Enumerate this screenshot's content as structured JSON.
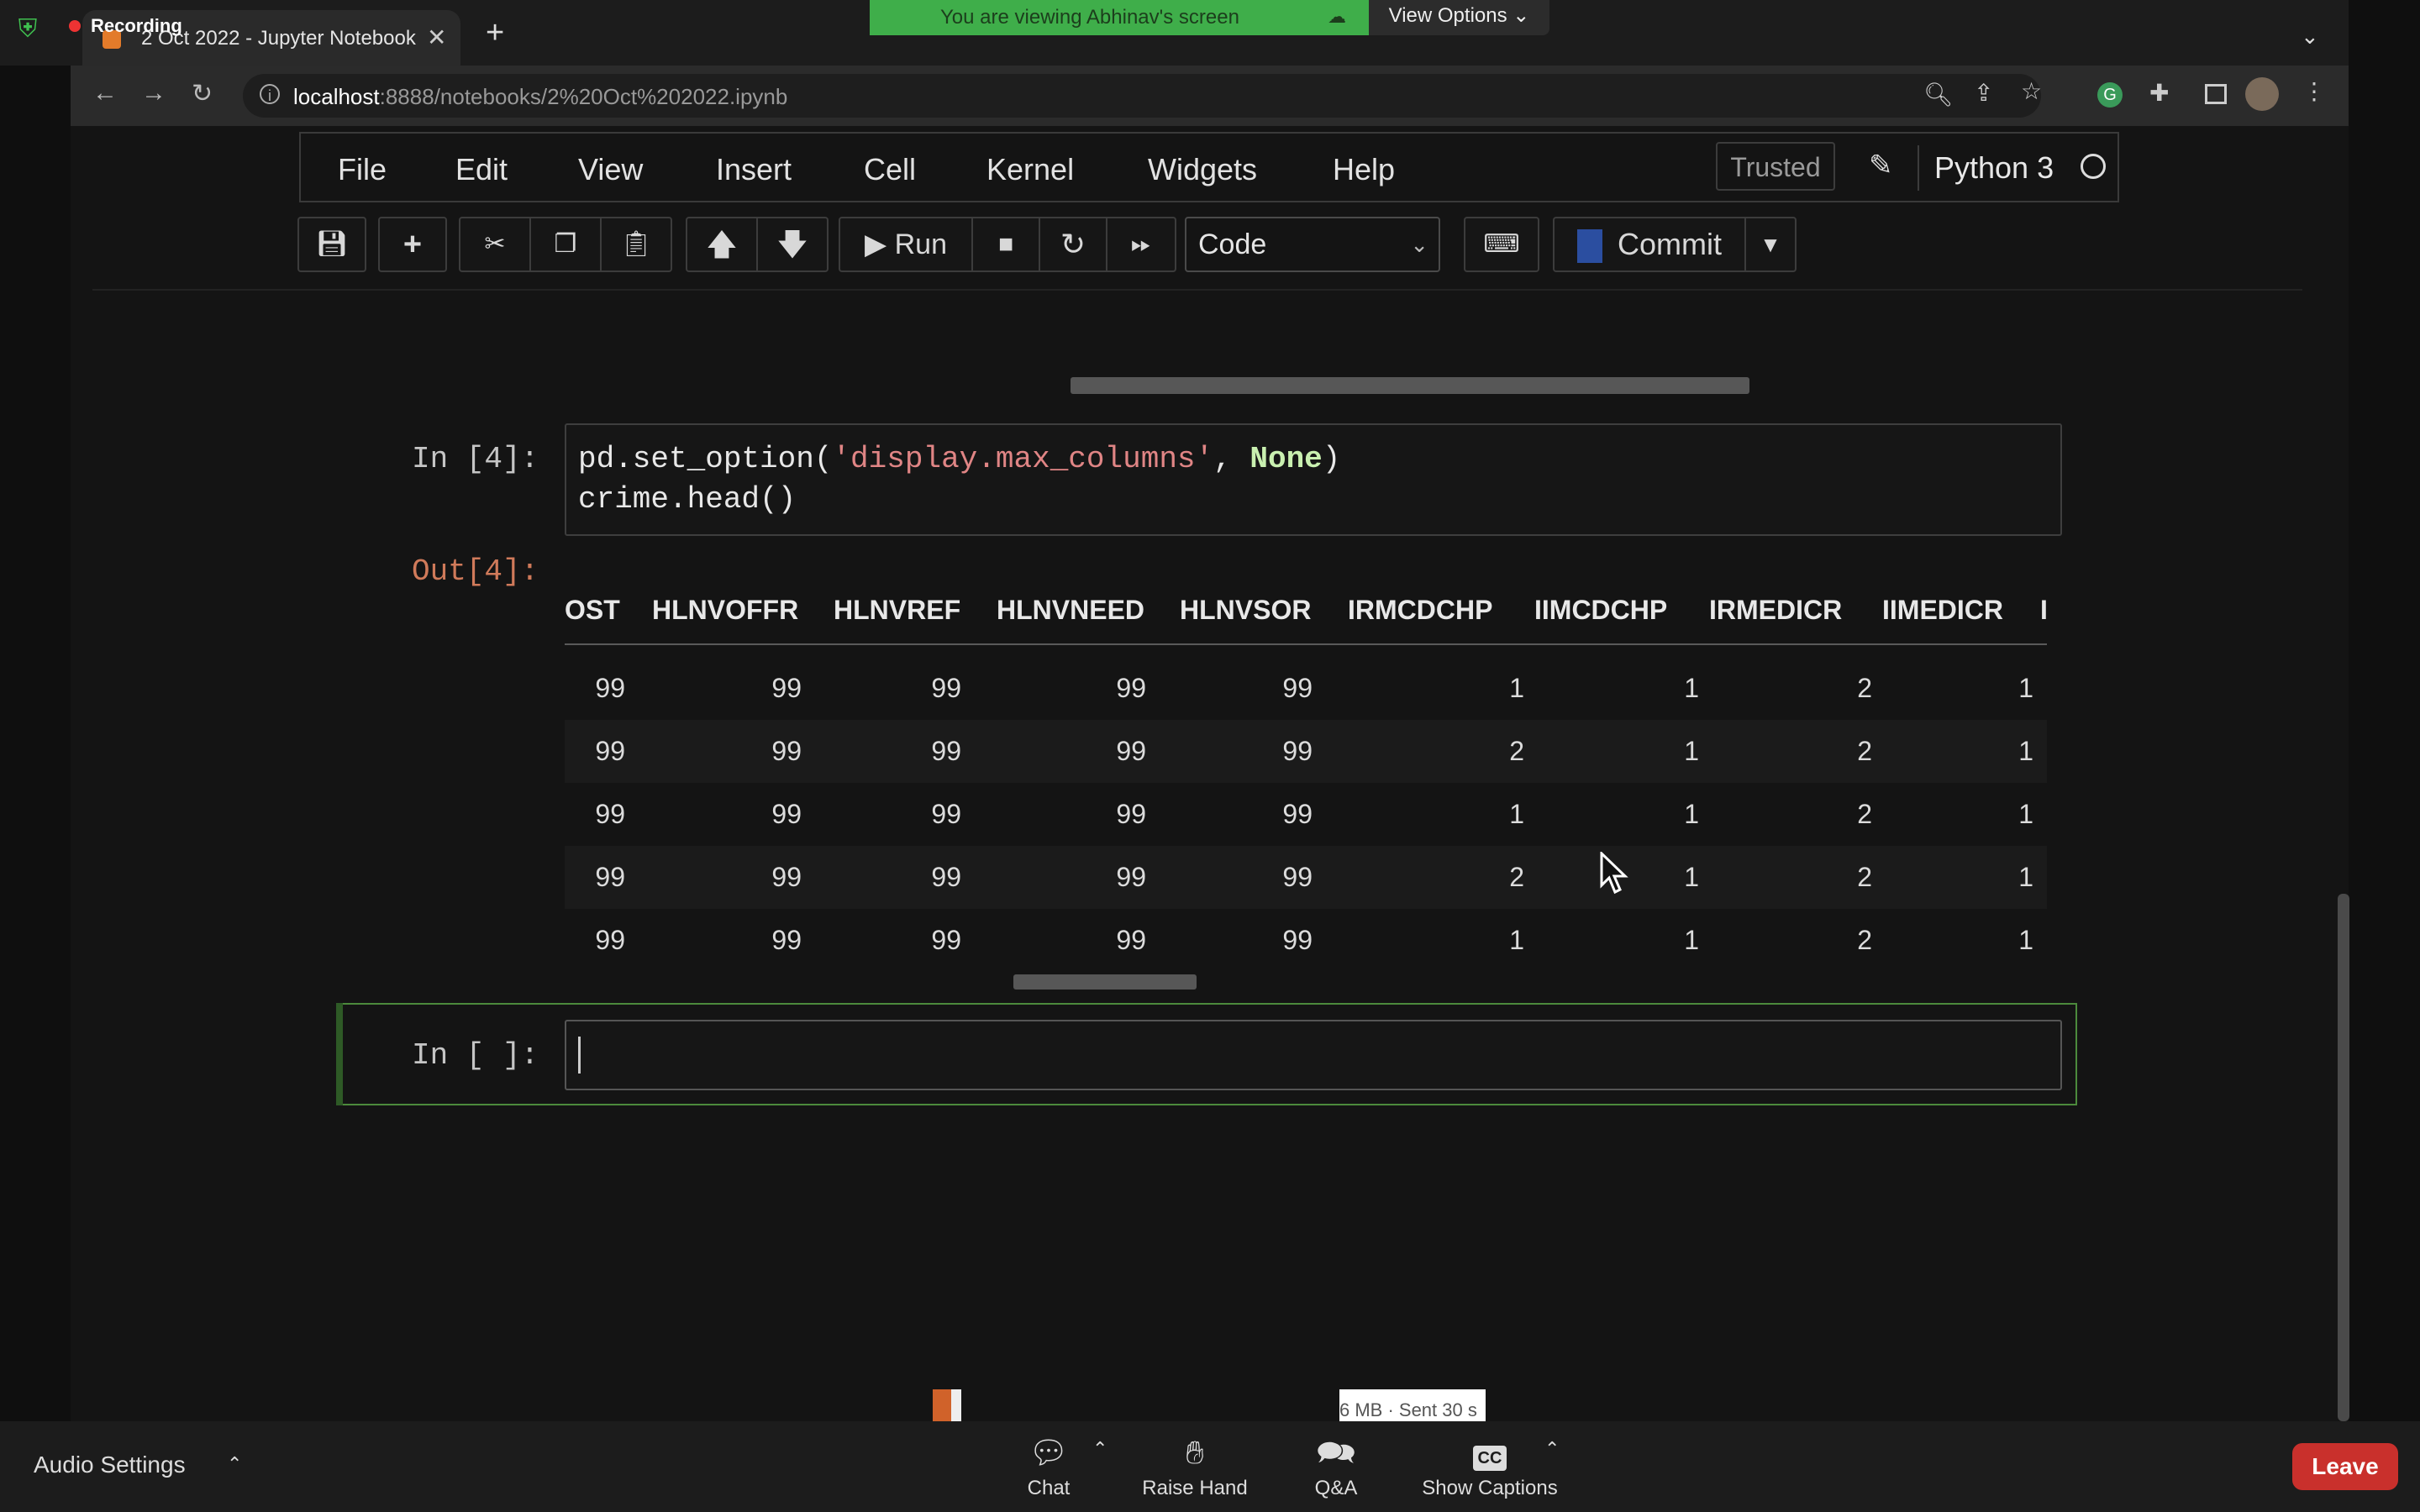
{
  "recording": {
    "label": "Recording"
  },
  "share_banner": {
    "text": "You are viewing Abhinav's screen",
    "view_options": "View Options ⌄"
  },
  "browser": {
    "tab_title": "2 Oct 2022 - Jupyter Notebook",
    "url_host": "localhost",
    "url_rest": ":8888/notebooks/2%20Oct%202022.ipynb"
  },
  "jupyter": {
    "menu": [
      "File",
      "Edit",
      "View",
      "Insert",
      "Cell",
      "Kernel",
      "Widgets",
      "Help"
    ],
    "trusted": "Trusted",
    "kernel": "Python 3",
    "toolbar": {
      "run": "Run",
      "cell_type": "Code",
      "commit": "Commit"
    }
  },
  "cells": {
    "in4_prompt": "In [4]:",
    "code_line1_pre": "pd.set_option(",
    "code_line1_str": "'display.max_columns'",
    "code_line1_mid": ", ",
    "code_line1_kw": "None",
    "code_line1_end": ")",
    "code_line2": "crime.head()",
    "out4_prompt": "Out[4]:",
    "empty_prompt": "In [ ]:"
  },
  "dataframe": {
    "columns": [
      "OST",
      "HLNVOFFR",
      "HLNVREF",
      "HLNVNEED",
      "HLNVSOR",
      "IRMCDCHP",
      "IIMCDCHP",
      "IRMEDICR",
      "IIMEDICR",
      "I"
    ],
    "rows": [
      [
        "99",
        "99",
        "99",
        "99",
        "99",
        "1",
        "1",
        "2",
        "1"
      ],
      [
        "99",
        "99",
        "99",
        "99",
        "99",
        "2",
        "1",
        "2",
        "1"
      ],
      [
        "99",
        "99",
        "99",
        "99",
        "99",
        "1",
        "1",
        "2",
        "1"
      ],
      [
        "99",
        "99",
        "99",
        "99",
        "99",
        "2",
        "1",
        "2",
        "1"
      ],
      [
        "99",
        "99",
        "99",
        "99",
        "99",
        "1",
        "1",
        "2",
        "1"
      ]
    ]
  },
  "overlay": {
    "sent_text": "6 MB · Sent 30 s"
  },
  "zoom_bar": {
    "audio_settings": "Audio Settings",
    "chat": "Chat",
    "raise_hand": "Raise Hand",
    "qa": "Q&A",
    "captions": "Show Captions",
    "captions_icon": "CC",
    "leave": "Leave"
  },
  "colors": {
    "accent_green": "#3fae4a",
    "leave_red": "#c9302c",
    "cell_border_selected": "#4c8a3c"
  }
}
